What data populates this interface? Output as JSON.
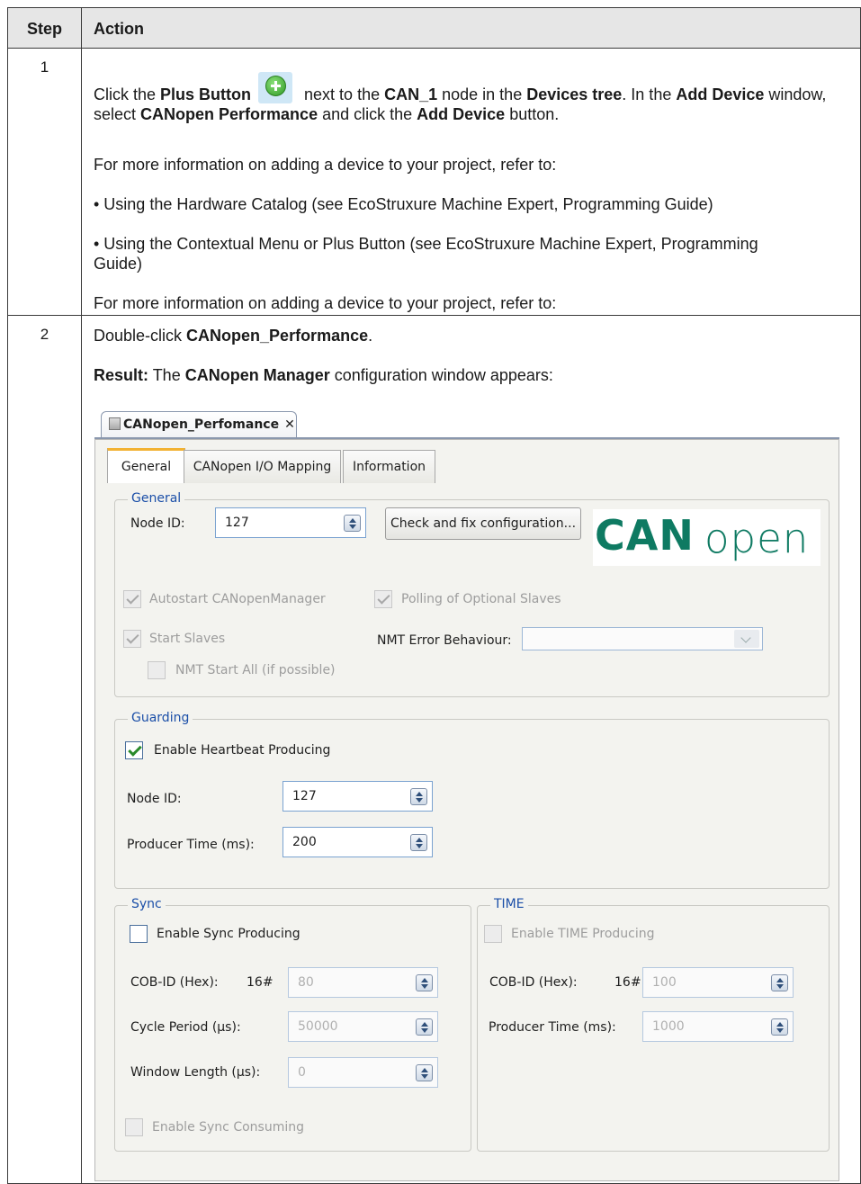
{
  "table": {
    "header_step": "Step",
    "header_action": "Action"
  },
  "row1": {
    "step": "1",
    "p1_a": "Click the ",
    "p1_b": "Plus Button",
    "p1_c": " next to the ",
    "p1_d": "CAN_1",
    "p1_e": " node in the ",
    "p1_f": "Devices tree",
    "p1_g": ". In the ",
    "p1_h": "Add Device",
    "p1_i": " window, select ",
    "p1_j": "CANopen Performance",
    "p1_k": " and click the ",
    "p1_l": "Add Device",
    "p1_m": " button.",
    "p2": "For more information on adding a device to your project, refer to:",
    "p3": "• Using the Hardware Catalog (see EcoStruxure Machine Expert, Programming Guide)",
    "p4": "• Using the Contextual Menu or Plus Button (see EcoStruxure Machine Expert, Programming Guide)",
    "p5": "For more information on adding a device to your project, refer to:",
    "icon": "plus-button-icon"
  },
  "row2": {
    "step": "2",
    "p1_a": "Double-click ",
    "p1_b": "CANopen_Performance",
    "p1_c": ".",
    "p2_a": "Result:",
    "p2_b": " The ",
    "p2_c": "CANopen Manager",
    "p2_d": " configuration window appears:"
  },
  "window": {
    "doc_tab": "CANopen_Perfomance",
    "close_glyph": "✕",
    "tabs": [
      "General",
      "CANopen I/O Mapping",
      "Information"
    ],
    "active_tab": "General",
    "general": {
      "legend": "General",
      "node_id_label": "Node ID:",
      "node_id_value": "127",
      "check_button": "Check and fix configuration...",
      "logo_can": "CAN",
      "logo_open": "open",
      "autostart": "Autostart CANopenManager",
      "polling": "Polling of Optional Slaves",
      "start_slaves": "Start Slaves",
      "nmt_error_label": "NMT Error Behaviour:",
      "nmt_error_value": "",
      "nmt_start_all": "NMT Start All (if possible)"
    },
    "guarding": {
      "legend": "Guarding",
      "enable_heartbeat": "Enable Heartbeat Producing",
      "enable_heartbeat_checked": true,
      "node_id_label": "Node ID:",
      "node_id_value": "127",
      "producer_time_label": "Producer Time (ms):",
      "producer_time_value": "200"
    },
    "sync": {
      "legend": "Sync",
      "enable_sync": "Enable Sync Producing",
      "cob_label": "COB-ID (Hex):",
      "cob_prefix": "16#",
      "cob_value": "80",
      "cycle_label": "Cycle Period (µs):",
      "cycle_value": "50000",
      "window_label": "Window Length (µs):",
      "window_value": "0",
      "enable_consuming": "Enable Sync Consuming"
    },
    "time": {
      "legend": "TIME",
      "enable_time": "Enable TIME Producing",
      "cob_label": "COB-ID (Hex):",
      "cob_prefix": "16#",
      "cob_value": "100",
      "producer_label": "Producer Time (ms):",
      "producer_value": "1000"
    },
    "colors": {
      "legend": "#1b4fa8",
      "active_tab_accent": "#f2b233",
      "logo": "#0e7a62"
    }
  }
}
